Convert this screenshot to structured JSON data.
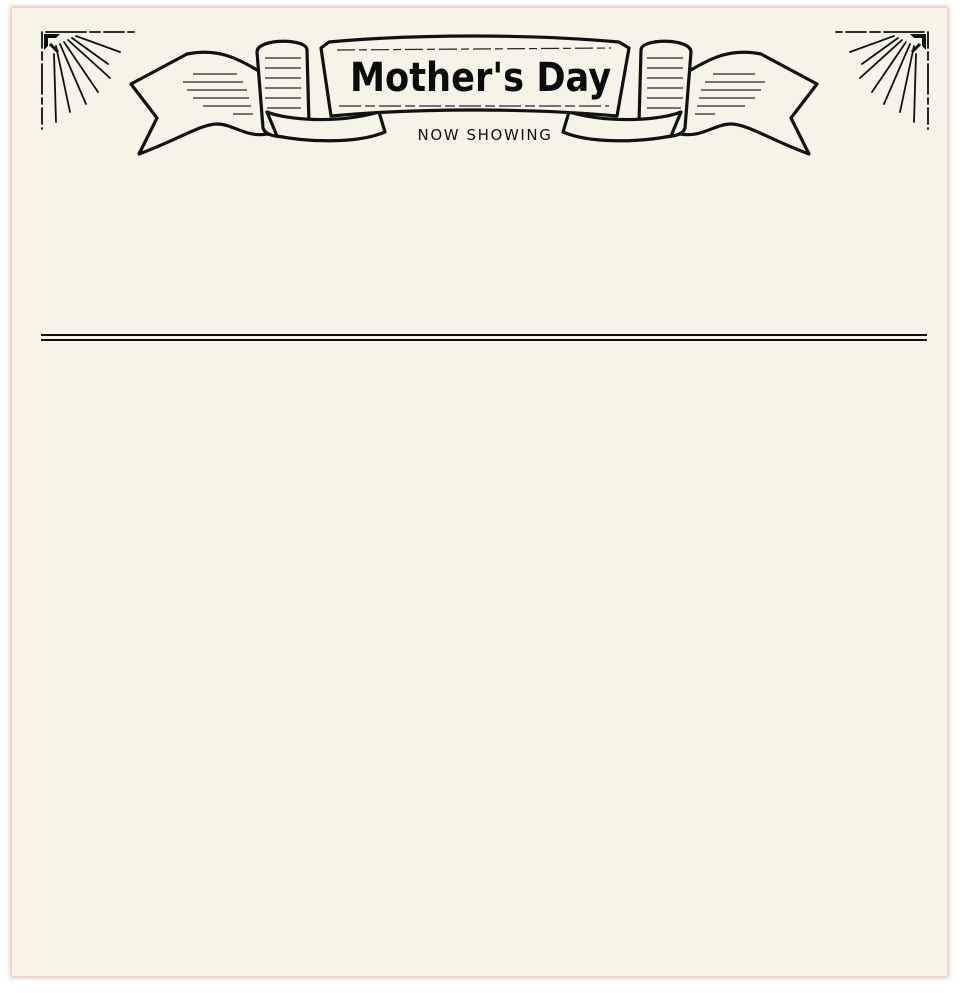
{
  "header": {
    "title": "Mother's Day",
    "subtitle": "NOW SHOWING"
  },
  "colors": {
    "paper": "#f5f4e6",
    "ink": "#0b0b0b",
    "border_glow": "#d28c8c"
  },
  "icons": {
    "banner": "scroll-banner-icon",
    "corner_left": "sunburst-corner-icon",
    "corner_right": "sunburst-corner-icon"
  }
}
